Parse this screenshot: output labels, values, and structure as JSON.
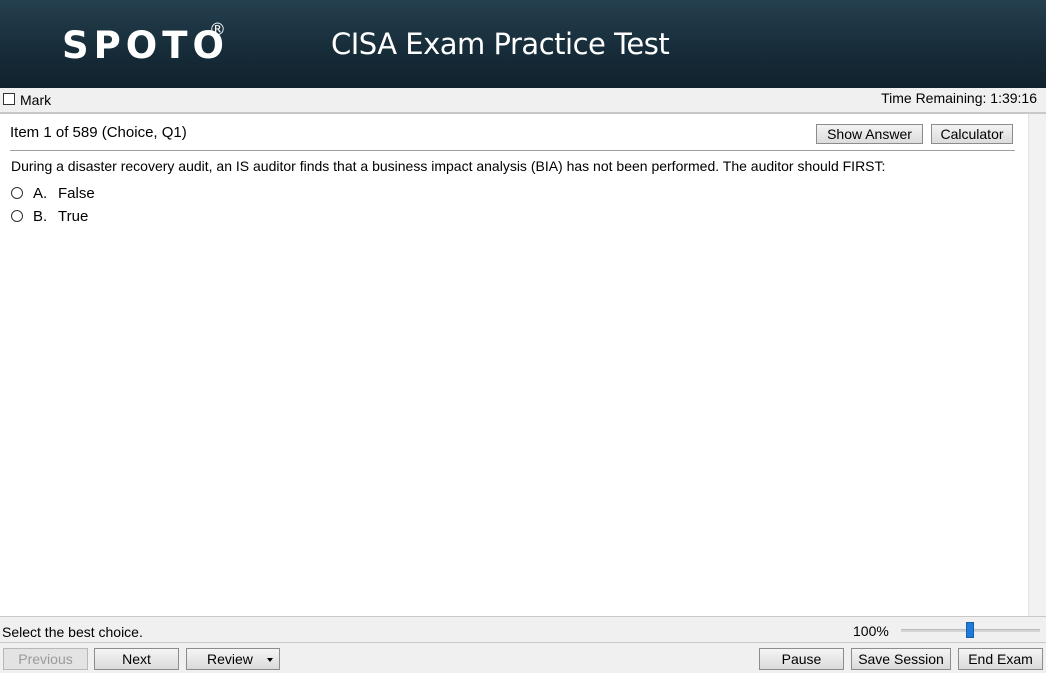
{
  "header": {
    "logo_text": "SPOTO",
    "logo_reg": "®",
    "title": "CISA Exam Practice Test"
  },
  "markbar": {
    "mark_label": "Mark",
    "time_remaining": "Time Remaining: 1:39:16"
  },
  "item": {
    "title": "Item 1 of 589 (Choice, Q1)",
    "show_answer_label": "Show Answer",
    "calculator_label": "Calculator",
    "question": "During a disaster recovery audit, an IS auditor finds that a business impact analysis (BIA) has not been performed. The auditor should FIRST:",
    "options": [
      {
        "letter": "A.",
        "text": "False"
      },
      {
        "letter": "B.",
        "text": "True"
      }
    ]
  },
  "status": {
    "text": "Select the best choice.",
    "zoom": "100%"
  },
  "nav": {
    "previous": "Previous",
    "next": "Next",
    "review": "Review",
    "pause": "Pause",
    "save_session": "Save Session",
    "end_exam": "End Exam"
  },
  "colors": {
    "header_bg": "#1a2f3c",
    "accent": "#1e7bdc"
  },
  "icons": {
    "mark": "checkbox-icon",
    "option": "radio-icon",
    "review_menu": "caret-down-icon"
  }
}
